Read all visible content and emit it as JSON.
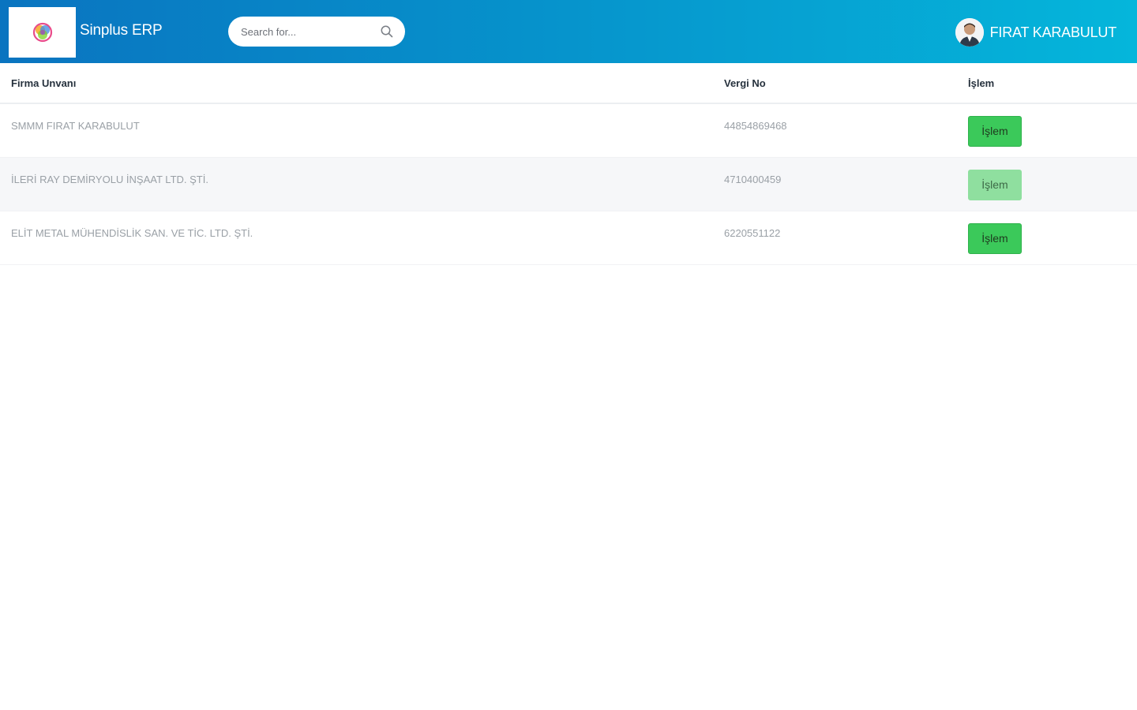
{
  "header": {
    "brand": "Sinplus ERP",
    "logo_icon": "colorful-globe-logo-icon",
    "search": {
      "placeholder": "Search for...",
      "icon": "search-icon"
    },
    "user": {
      "name": "FIRAT KARABULUT",
      "avatar_icon": "user-avatar-icon"
    },
    "gradient_colors": [
      "#0a74c0",
      "#05b6db"
    ]
  },
  "table": {
    "columns": [
      "Firma Unvanı",
      "Vergi No",
      "İşlem"
    ],
    "rows": [
      {
        "company": "SMMM FIRAT KARABULUT",
        "tax_no": "44854869468",
        "action": "İşlem",
        "enabled": true
      },
      {
        "company": "İLERİ RAY DEMİRYOLU İNŞAAT LTD. ŞTİ.",
        "tax_no": "4710400459",
        "action": "İşlem",
        "enabled": false
      },
      {
        "company": "ELİT METAL MÜHENDİSLİK SAN. VE TİC. LTD. ŞTİ.",
        "tax_no": "6220551122",
        "action": "İşlem",
        "enabled": true
      }
    ]
  },
  "colors": {
    "button_green": "#3bc95a",
    "button_disabled": "#8fdf9f"
  }
}
